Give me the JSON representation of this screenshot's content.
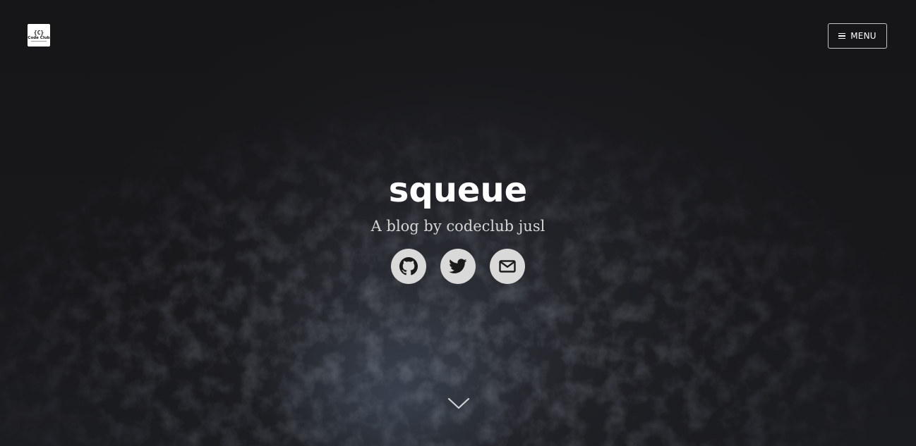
{
  "header": {
    "logo": {
      "mark": "{C}",
      "text": "Code Club",
      "icon": "code-club-logo"
    },
    "menu_button": {
      "label": "MENU",
      "icon": "hamburger-icon"
    }
  },
  "hero": {
    "title": "squeue",
    "tagline": "A blog by codeclub jusl",
    "social_links": [
      {
        "name": "GitHub",
        "icon": "github-icon"
      },
      {
        "name": "Twitter",
        "icon": "twitter-icon"
      },
      {
        "name": "Email",
        "icon": "mail-icon"
      }
    ],
    "scroll_icon": "chevron-down-icon"
  },
  "colors": {
    "background": "#141416",
    "title": "#ffffff",
    "tagline": "#d6d6d6",
    "social_circle": "#d9d9d9",
    "social_icon": "#1a1a1a"
  }
}
